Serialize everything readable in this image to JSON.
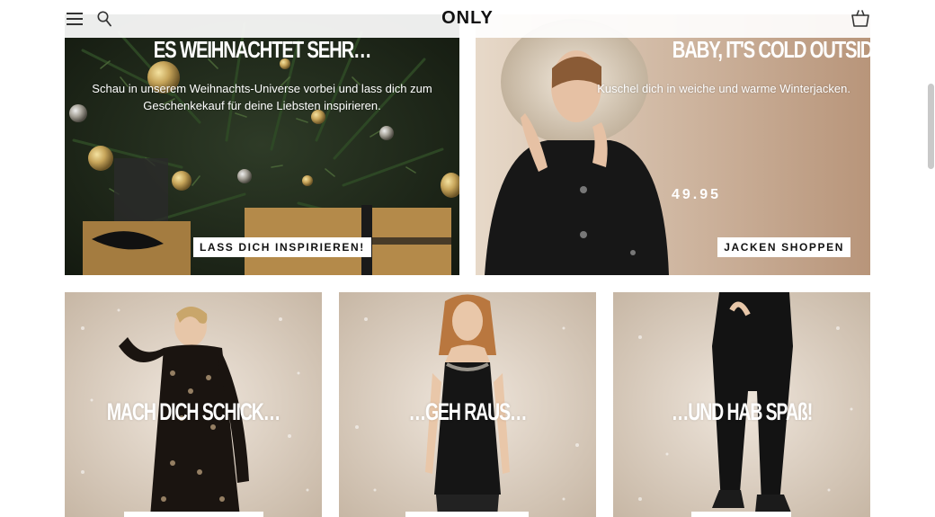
{
  "header": {
    "logo": "ONLY",
    "icons": [
      "menu-icon",
      "search-icon",
      "cart-icon"
    ]
  },
  "hero": [
    {
      "title": "ES WEIHNACHTET SEHR…",
      "text": "Schau in unserem Weihnachts-Universe vorbei und lass dich zum Geschenkekauf für deine Liebsten inspirieren.",
      "cta": "LASS DICH INSPIRIEREN!"
    },
    {
      "title": "BABY, IT'S COLD OUTSIDE!",
      "text": "Kuschel dich in weiche und warme Winterjacken.",
      "price": "49.95",
      "cta": "JACKEN SHOPPEN"
    }
  ],
  "tiles": [
    {
      "title": "MACH DICH SCHICK…"
    },
    {
      "title": "…GEH RAUS…"
    },
    {
      "title": "…UND HAB SPAß!"
    }
  ],
  "colors": {
    "hero_left_bg": "#1d2418",
    "hero_right_bg": "#cbb6a3",
    "tile_bg": "#ddd2c7",
    "text_dark": "#111111"
  }
}
